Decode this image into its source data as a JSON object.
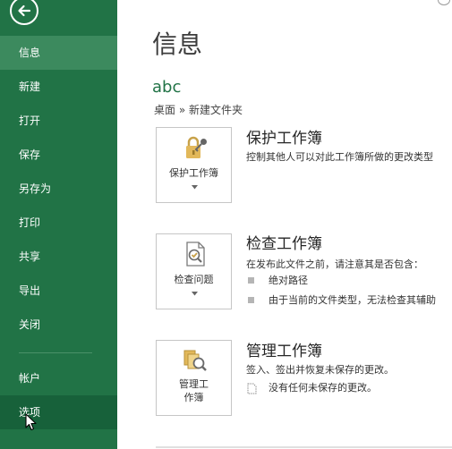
{
  "sidebar": {
    "items": [
      {
        "label": "信息",
        "state": "active"
      },
      {
        "label": "新建",
        "state": "normal"
      },
      {
        "label": "打开",
        "state": "normal"
      },
      {
        "label": "保存",
        "state": "normal"
      },
      {
        "label": "另存为",
        "state": "normal"
      },
      {
        "label": "打印",
        "state": "normal"
      },
      {
        "label": "共享",
        "state": "normal"
      },
      {
        "label": "导出",
        "state": "normal"
      },
      {
        "label": "关闭",
        "state": "normal"
      }
    ],
    "bottom_items": [
      {
        "label": "帐户",
        "state": "normal"
      },
      {
        "label": "选项",
        "state": "hover"
      }
    ]
  },
  "main": {
    "title": "信息",
    "file_name": "abc",
    "breadcrumb": "桌面 » 新建文件夹",
    "sections": {
      "protect": {
        "button_label": "保护工作簿",
        "title": "保护工作簿",
        "description": "控制其他人可以对此工作簿所做的更改类型"
      },
      "inspect": {
        "button_label": "检查问题",
        "title": "检查工作簿",
        "description": "在发布此文件之前，请注意其是否包含：",
        "bullets": [
          "绝对路径",
          "由于当前的文件类型，无法检查其辅助"
        ]
      },
      "manage": {
        "button_label_line1": "管理工",
        "button_label_line2": "作簿",
        "title": "管理工作簿",
        "description": "签入、签出并恢复未保存的更改。",
        "status": "没有任何未保存的更改。"
      }
    }
  },
  "colors": {
    "sidebar_bg": "#217346",
    "sidebar_active": "#3c8a5e",
    "sidebar_hover": "#17613a",
    "accent_text": "#217346"
  }
}
